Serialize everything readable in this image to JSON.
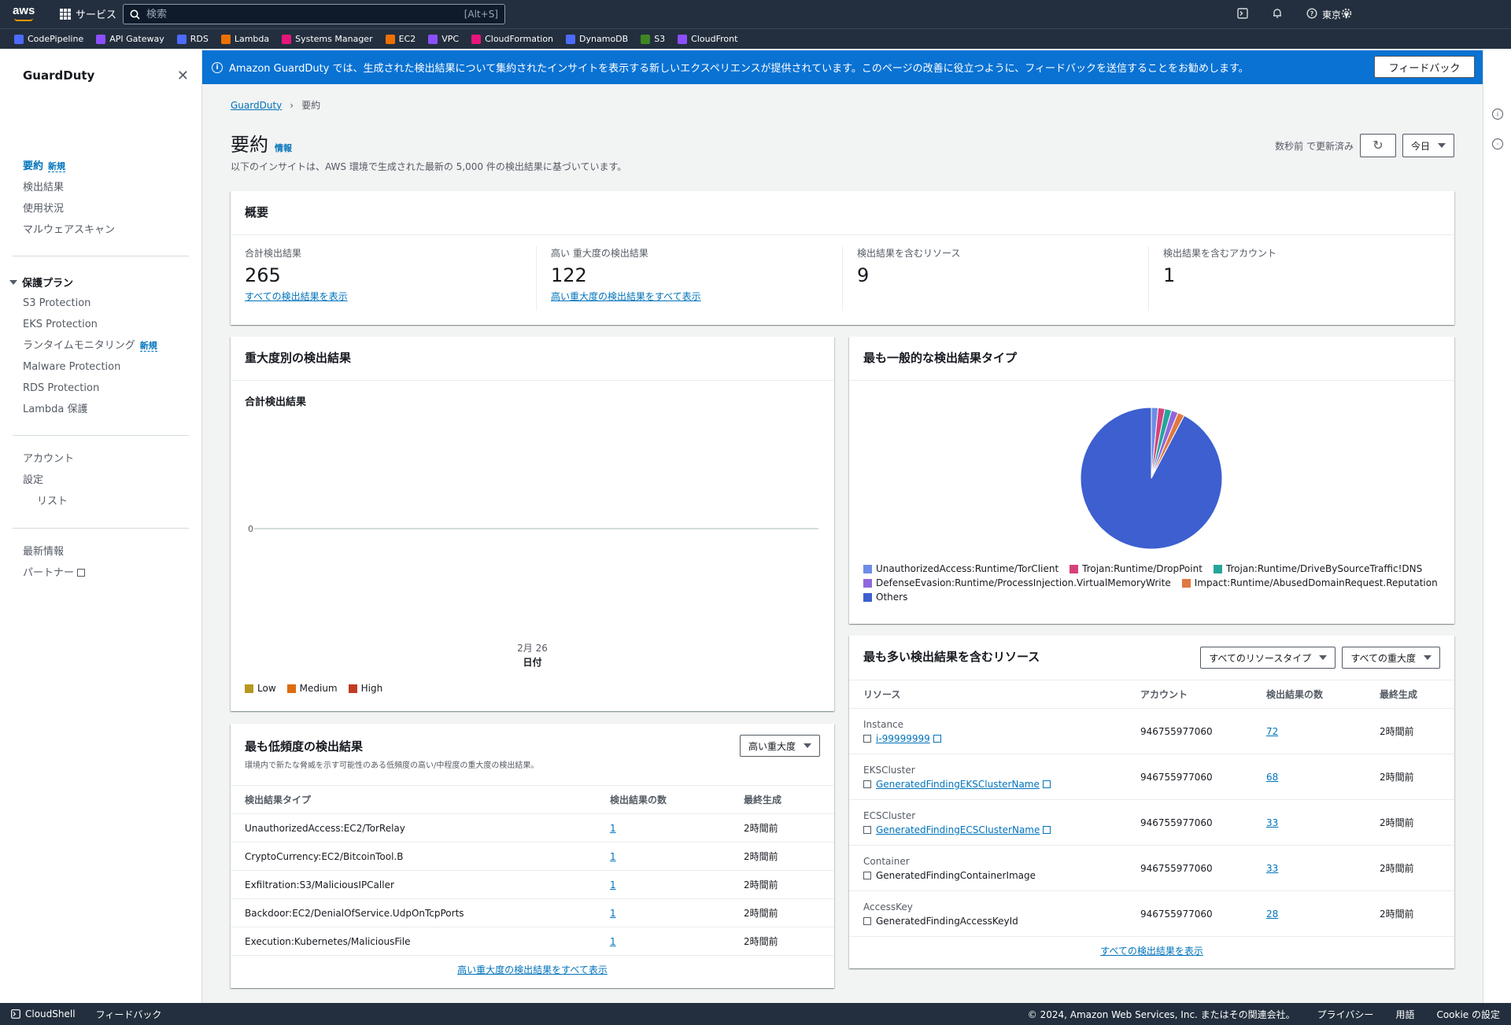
{
  "topnav": {
    "logo": "aws",
    "services_label": "サービス",
    "search_placeholder": "検索",
    "search_shortcut": "[Alt+S]",
    "region": "東京 ▾"
  },
  "favorites": [
    {
      "label": "CodePipeline",
      "color": "#4d6bfe"
    },
    {
      "label": "API Gateway",
      "color": "#8c4fff"
    },
    {
      "label": "RDS",
      "color": "#4d6bfe"
    },
    {
      "label": "Lambda",
      "color": "#ed7100"
    },
    {
      "label": "Systems Manager",
      "color": "#e7157b"
    },
    {
      "label": "EC2",
      "color": "#ed7100"
    },
    {
      "label": "VPC",
      "color": "#8c4fff"
    },
    {
      "label": "CloudFormation",
      "color": "#e7157b"
    },
    {
      "label": "DynamoDB",
      "color": "#4d6bfe"
    },
    {
      "label": "S3",
      "color": "#3f8624"
    },
    {
      "label": "CloudFront",
      "color": "#8c4fff"
    }
  ],
  "banner": {
    "text": "Amazon GuardDuty では、生成された検出結果について集約されたインサイトを表示する新しいエクスペリエンスが提供されています。このページの改善に役立つように、フィードバックを送信することをお勧めします。",
    "button": "フィードバック"
  },
  "sidebar": {
    "title": "GuardDuty",
    "new_badge": "新規",
    "items_top": [
      "要約",
      "検出結果",
      "使用状況",
      "マルウェアスキャン"
    ],
    "section_label": "保護プラン",
    "plans": [
      "S3 Protection",
      "EKS Protection",
      "ランタイムモニタリング",
      "Malware Protection",
      "RDS Protection",
      "Lambda 保護"
    ],
    "items_mid": [
      "アカウント",
      "設定",
      "リスト"
    ],
    "items_bottom": [
      "最新情報",
      "パートナー"
    ]
  },
  "breadcrumb": {
    "root": "GuardDuty",
    "current": "要約"
  },
  "page": {
    "title": "要約",
    "info": "情報",
    "description": "以下のインサイトは、AWS 環境で生成された最新の 5,000 件の検出結果に基づいています。",
    "updated": "数秒前 で更新済み",
    "range": "今日"
  },
  "overview": {
    "title": "概要",
    "metrics": [
      {
        "label": "合計検出結果",
        "value": "265",
        "link": "すべての検出結果を表示"
      },
      {
        "label": "高い 重大度の検出結果",
        "value": "122",
        "link": "高い重大度の検出結果をすべて表示"
      },
      {
        "label": "検出結果を含むリソース",
        "value": "9",
        "link": ""
      },
      {
        "label": "検出結果を含むアカウント",
        "value": "1",
        "link": ""
      }
    ]
  },
  "severity_card": {
    "title": "重大度別の検出結果",
    "subtitle": "合計検出結果",
    "y_tick": "0",
    "x_tick": "2月 26",
    "x_label": "日付",
    "legend": [
      {
        "label": "Low",
        "color": "#b7981f"
      },
      {
        "label": "Medium",
        "color": "#dd6b10"
      },
      {
        "label": "High",
        "color": "#c23b22"
      }
    ]
  },
  "chart_data": {
    "type": "pie",
    "title": "最も一般的な検出結果タイプ",
    "slices": [
      {
        "label": "UnauthorizedAccess:Runtime/TorClient",
        "value": 1,
        "color": "#6d8de6"
      },
      {
        "label": "Trojan:Runtime/DropPoint",
        "value": 1,
        "color": "#d6417b"
      },
      {
        "label": "Trojan:Runtime/DriveBySourceTraffic!DNS",
        "value": 1,
        "color": "#25a69a"
      },
      {
        "label": "DefenseEvasion:Runtime/ProcessInjection.VirtualMemoryWrite",
        "value": 1,
        "color": "#9166dc"
      },
      {
        "label": "Impact:Runtime/AbusedDomainRequest.Reputation",
        "value": 1,
        "color": "#e07941"
      },
      {
        "label": "Others",
        "value": 60,
        "color": "#3d5fd0"
      }
    ],
    "legend_placement": "bottom"
  },
  "least_frequent": {
    "title": "最も低頻度の検出結果",
    "description": "環境内で新たな脅威を示す可能性のある低頻度の高い/中程度の重大度の検出結果。",
    "filter": "高い重大度",
    "columns": [
      "検出結果タイプ",
      "検出結果の数",
      "最終生成"
    ],
    "rows": [
      {
        "type": "UnauthorizedAccess:EC2/TorRelay",
        "count": "1",
        "last": "2時間前"
      },
      {
        "type": "CryptoCurrency:EC2/BitcoinTool.B",
        "count": "1",
        "last": "2時間前"
      },
      {
        "type": "Exfiltration:S3/MaliciousIPCaller",
        "count": "1",
        "last": "2時間前"
      },
      {
        "type": "Backdoor:EC2/DenialOfService.UdpOnTcpPorts",
        "count": "1",
        "last": "2時間前"
      },
      {
        "type": "Execution:Kubernetes/MaliciousFile",
        "count": "1",
        "last": "2時間前"
      }
    ],
    "footer_link": "高い重大度の検出結果をすべて表示"
  },
  "resources": {
    "title": "最も多い検出結果を含むリソース",
    "filter_type": "すべてのリソースタイプ",
    "filter_severity": "すべての重大度",
    "columns": [
      "リソース",
      "アカウント",
      "検出結果の数",
      "最終生成"
    ],
    "rows": [
      {
        "kind": "Instance",
        "name": "i-99999999",
        "link": true,
        "account": "946755977060",
        "count": "72",
        "last": "2時間前"
      },
      {
        "kind": "EKSCluster",
        "name": "GeneratedFindingEKSClusterName",
        "link": true,
        "account": "946755977060",
        "count": "68",
        "last": "2時間前"
      },
      {
        "kind": "ECSCluster",
        "name": "GeneratedFindingECSClusterName",
        "link": true,
        "account": "946755977060",
        "count": "33",
        "last": "2時間前"
      },
      {
        "kind": "Container",
        "name": "GeneratedFindingContainerImage",
        "link": false,
        "account": "946755977060",
        "count": "33",
        "last": "2時間前"
      },
      {
        "kind": "AccessKey",
        "name": "GeneratedFindingAccessKeyId",
        "link": false,
        "account": "946755977060",
        "count": "28",
        "last": "2時間前"
      }
    ],
    "footer_link": "すべての検出結果を表示"
  },
  "footer": {
    "cloudshell": "CloudShell",
    "feedback": "フィードバック",
    "copyright": "© 2024, Amazon Web Services, Inc. またはその関連会社。",
    "privacy": "プライバシー",
    "terms": "用語",
    "cookies": "Cookie の設定"
  }
}
